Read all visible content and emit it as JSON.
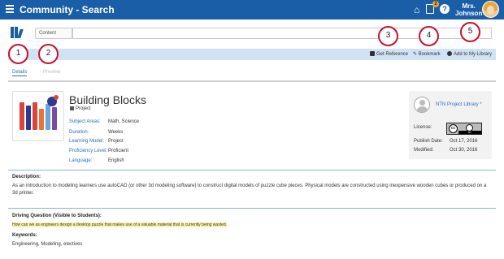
{
  "header": {
    "title": "Community - Search",
    "notification_count": "2",
    "help_glyph": "?",
    "user_line1": "Mrs.",
    "user_line2": "Johnson"
  },
  "search": {
    "label": "Content",
    "value": ""
  },
  "actions": {
    "get_reference": "Get Reference",
    "bookmark": "Bookmark",
    "add_to_library": "Add to My Library"
  },
  "tabs": {
    "details": "Details",
    "preview": "Preview"
  },
  "resource": {
    "title": "Building Blocks",
    "type": "Project",
    "fields": [
      {
        "label": "Subject Areas:",
        "value": "Math, Science"
      },
      {
        "label": "Duration:",
        "value": "Weeks"
      },
      {
        "label": "Learning Model:",
        "value": "Project"
      },
      {
        "label": "Proficiency Level:",
        "value": "Proficient"
      },
      {
        "label": "Language:",
        "value": "English"
      }
    ]
  },
  "info_card": {
    "library": "NTN Project Library",
    "library_mark": "*",
    "license_label": "License:",
    "license_cc": "cc",
    "license_by": "BY",
    "publish_label": "Publish Date:",
    "publish_value": "Oct 17, 2016",
    "modified_label": "Modified:",
    "modified_value": "Oct 30, 2016"
  },
  "description": {
    "title": "Description:",
    "text": "As an introduction to modeling learners use autoCAD (or other 3d modeling software) to construct digital models of puzzle cube pieces. Physical models are constructed using inexpensive wooden cubes or produced on a 3d printer."
  },
  "driving_question": {
    "title": "Driving Question (Visible to Students):",
    "text": "How can we as engineers design a desktop puzzle that makes use of a valuable material that is currently being wasted."
  },
  "keywords": {
    "title": "Keywords:",
    "text": "Engineering, Modeling, electives"
  },
  "callouts": [
    "1",
    "2",
    "3",
    "4",
    "5"
  ],
  "colors": {
    "header_bg": "#1a5ea8",
    "accent_link": "#2a6ebb",
    "action_bar_bg": "#cfe3f5",
    "callout_red": "#c8102e"
  }
}
